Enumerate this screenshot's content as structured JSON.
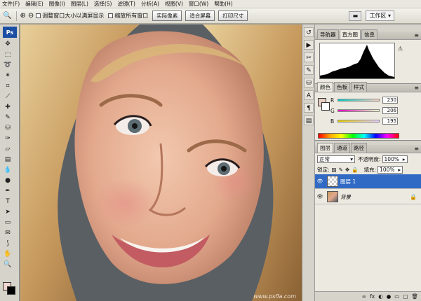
{
  "menu": [
    "文件(F)",
    "编辑(E)",
    "图像(I)",
    "图层(L)",
    "选择(S)",
    "滤镜(T)",
    "分析(A)",
    "视图(V)",
    "窗口(W)",
    "帮助(H)"
  ],
  "options": {
    "resize_label": "调整窗口大小以满屏显示",
    "zoom_all_label": "缩放所有窗口",
    "actual_pixels": "实际像素",
    "fit_screen": "适合屏幕",
    "print_size": "打印尺寸",
    "workspace": "工作区"
  },
  "watermark": "www.psfla.com",
  "nav_tabs": [
    "导航器",
    "直方图",
    "信息"
  ],
  "color_tabs": [
    "颜色",
    "色板",
    "样式"
  ],
  "color": {
    "r_label": "R",
    "g_label": "G",
    "b_label": "B",
    "r": "230",
    "g": "206",
    "b": "195",
    "fg_hex": "#e6cec3"
  },
  "layer_tabs": [
    "图层",
    "通道",
    "路径"
  ],
  "layers": {
    "blend_mode": "正常",
    "opacity_label": "不透明度:",
    "opacity": "100%",
    "lock_label": "锁定:",
    "fill_label": "填充:",
    "fill": "100%",
    "items": [
      {
        "name": "图层 1",
        "selected": true
      },
      {
        "name": "背景",
        "selected": false
      }
    ],
    "footer": [
      "∞",
      "fx",
      "◐",
      "●",
      "▭",
      "▢",
      "🗑"
    ]
  },
  "colors": {
    "accent": "#316ac5"
  }
}
